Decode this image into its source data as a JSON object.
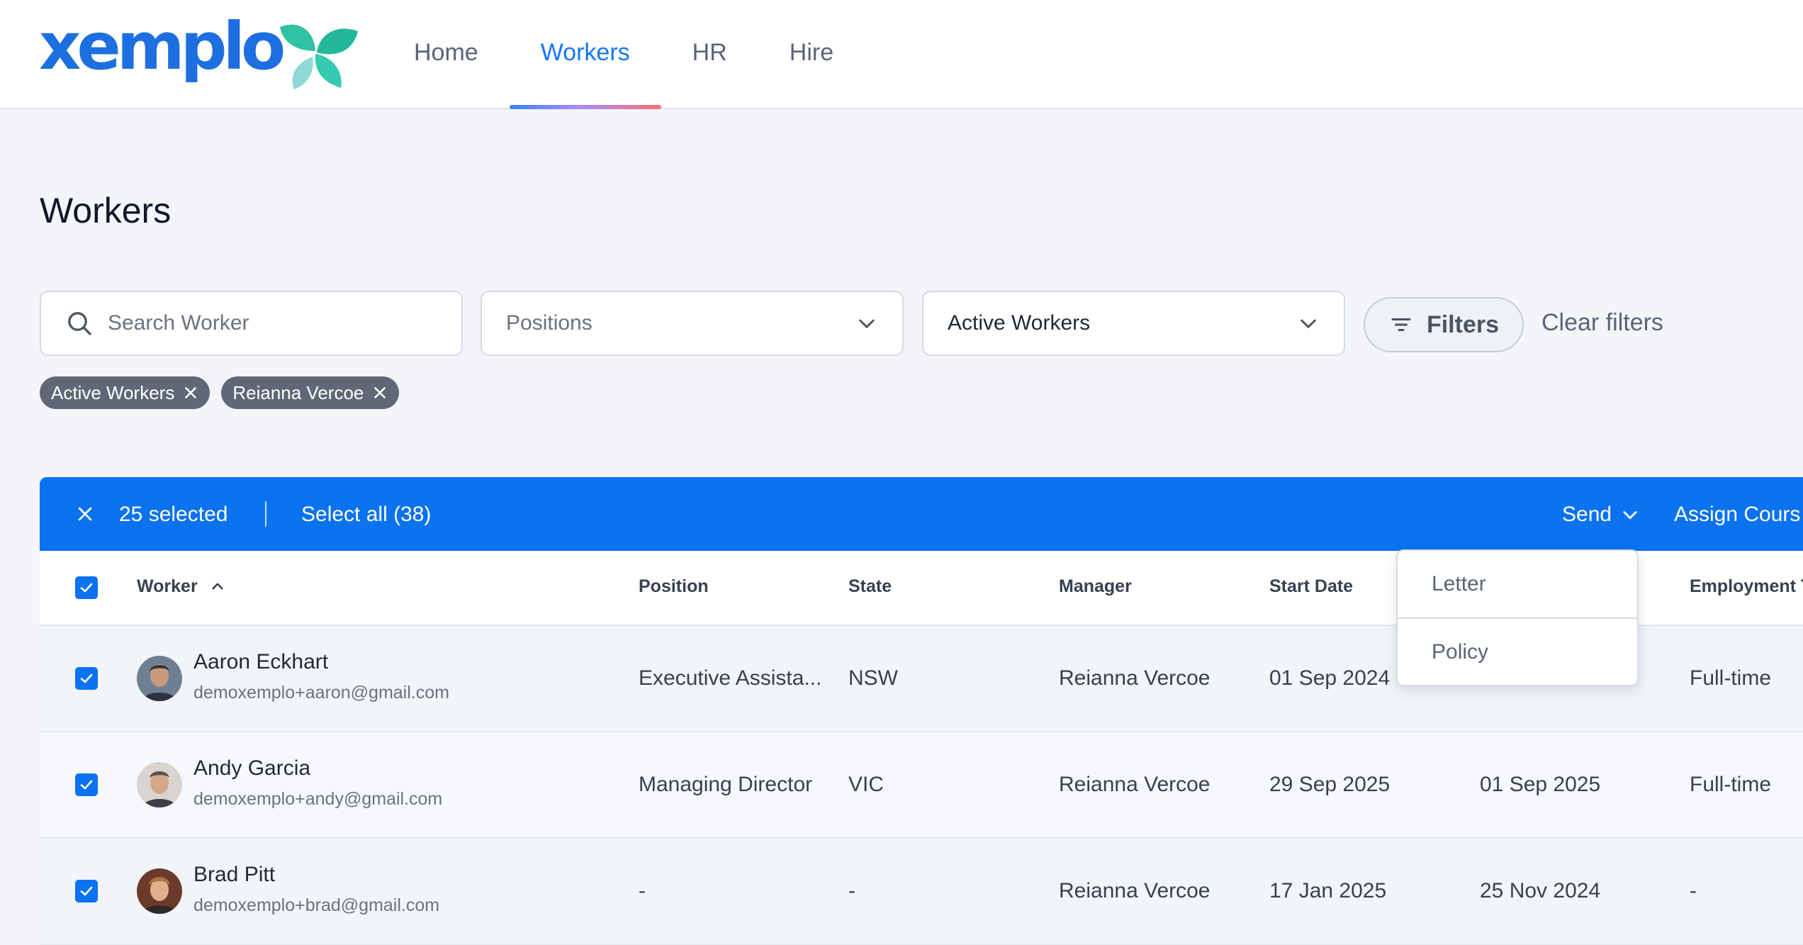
{
  "brand": {
    "logo_text": "xemplo",
    "logo_arrow": "»"
  },
  "nav": {
    "tabs": [
      {
        "label": "Home",
        "active": false
      },
      {
        "label": "Workers",
        "active": true
      },
      {
        "label": "HR",
        "active": false
      },
      {
        "label": "Hire",
        "active": false
      }
    ]
  },
  "page": {
    "title": "Workers"
  },
  "filters": {
    "search_placeholder": "Search Worker",
    "positions_value": "Positions",
    "status_value": "Active Workers",
    "filters_label": "Filters",
    "clear_label": "Clear filters",
    "chips": [
      "Active Workers",
      "Reianna Vercoe"
    ]
  },
  "selection_bar": {
    "count_label": "25 selected",
    "select_all_label": "Select all (38)",
    "send_label": "Send",
    "assign_label": "Assign Cours"
  },
  "send_menu": {
    "items": [
      "Letter",
      "Policy"
    ]
  },
  "table": {
    "columns": {
      "worker": "Worker",
      "position": "Position",
      "state": "State",
      "manager": "Manager",
      "start_date": "Start Date",
      "employment": "Employment T"
    },
    "rows": [
      {
        "name": "Aaron Eckhart",
        "email": "demoxemplo+aaron@gmail.com",
        "position": "Executive Assista...",
        "state": "NSW",
        "manager": "Reianna Vercoe",
        "start_date": "01 Sep 2024",
        "hidden_date": "",
        "employment": "Full-time",
        "checked": true
      },
      {
        "name": "Andy Garcia",
        "email": "demoxemplo+andy@gmail.com",
        "position": "Managing Director",
        "state": "VIC",
        "manager": "Reianna Vercoe",
        "start_date": "29 Sep 2025",
        "hidden_date": "01 Sep 2025",
        "employment": "Full-time",
        "checked": true
      },
      {
        "name": "Brad Pitt",
        "email": "demoxemplo+brad@gmail.com",
        "position": "-",
        "state": "-",
        "manager": "Reianna Vercoe",
        "start_date": "17 Jan 2025",
        "hidden_date": "25 Nov 2024",
        "employment": "-",
        "checked": true
      }
    ]
  },
  "colors": {
    "primary": "#0b72f0",
    "nav_active": "#1677f6",
    "chip_bg": "#5f6877",
    "page_bg": "#f3f5f9",
    "logo_blue": "#1d6fe0",
    "logo_teal": "#2fc2a4"
  },
  "icons": [
    "search-icon",
    "chevron-down-icon",
    "filter-lines-icon",
    "close-icon",
    "check-icon",
    "sort-up-icon",
    "leaf-icon"
  ]
}
